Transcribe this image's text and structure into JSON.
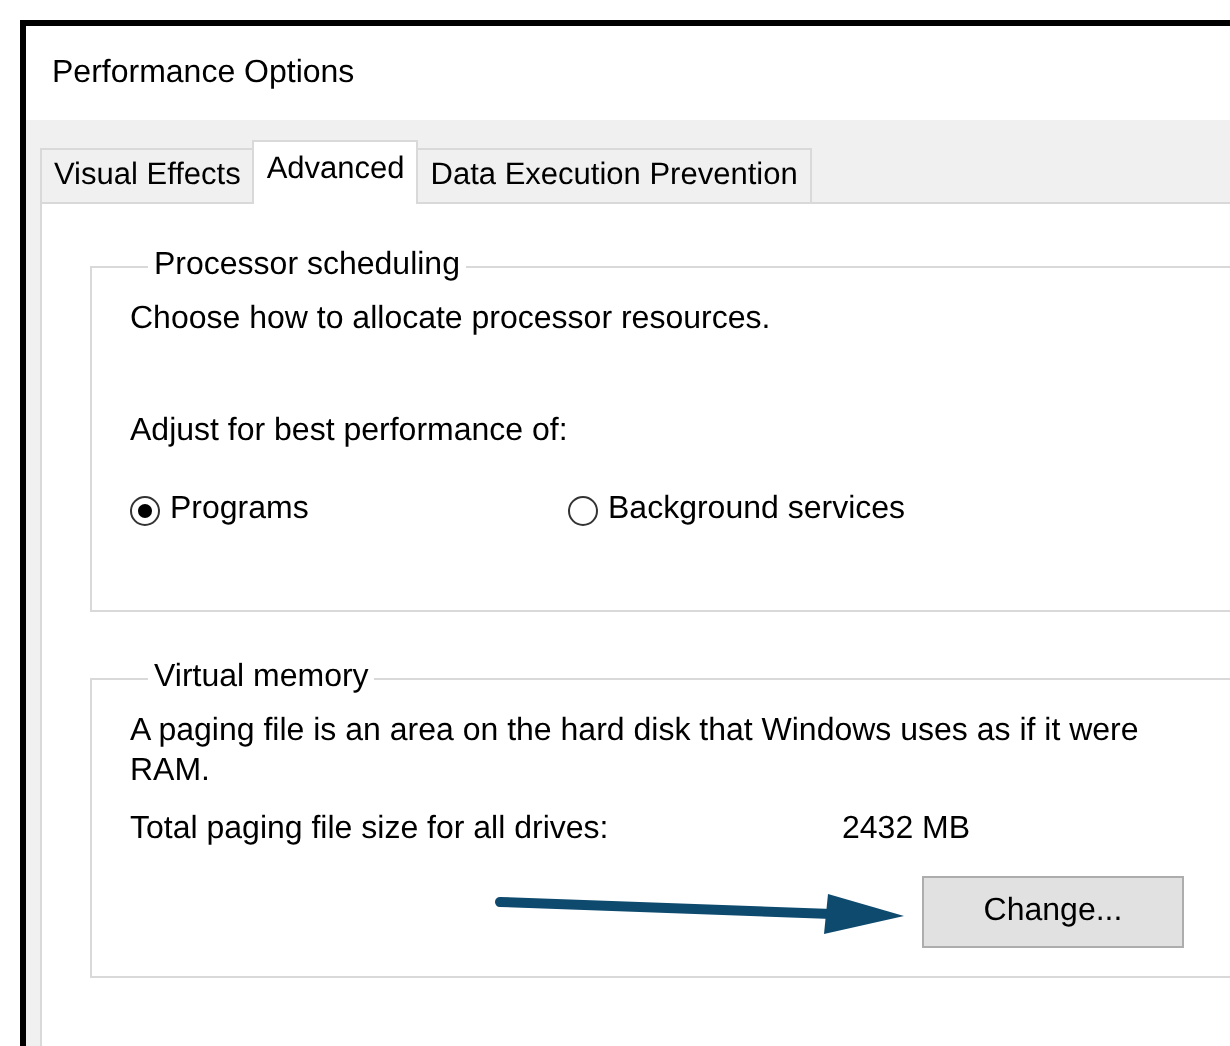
{
  "window": {
    "title": "Performance Options"
  },
  "tabs": [
    {
      "label": "Visual Effects",
      "selected": false
    },
    {
      "label": "Advanced",
      "selected": true
    },
    {
      "label": "Data Execution Prevention",
      "selected": false
    }
  ],
  "processor_scheduling": {
    "title": "Processor scheduling",
    "description": "Choose how to allocate processor resources.",
    "prompt": "Adjust for best performance of:",
    "options": [
      {
        "label": "Programs",
        "selected": true
      },
      {
        "label": "Background services",
        "selected": false
      }
    ]
  },
  "virtual_memory": {
    "title": "Virtual memory",
    "description": "A paging file is an area on the hard disk that Windows uses as if it were RAM.",
    "size_label": "Total paging file size for all drives:",
    "size_value": "2432 MB",
    "button": "Change..."
  },
  "annotation": {
    "kind": "arrow",
    "color": "#0d4a6e"
  }
}
